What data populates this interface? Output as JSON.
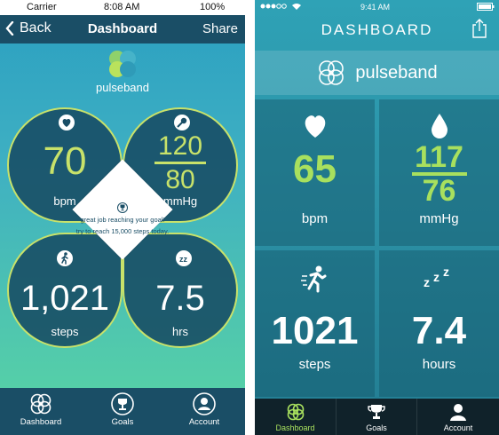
{
  "left": {
    "status": {
      "carrier": "Carrier",
      "time": "8:08 AM",
      "battery": "100%"
    },
    "nav": {
      "back": "Back",
      "title": "Dashboard",
      "share": "Share"
    },
    "brand": "pulseband",
    "heart_rate": {
      "value": "70",
      "unit": "bpm",
      "icon": "heart-icon"
    },
    "blood_pressure": {
      "systolic": "120",
      "diastolic": "80",
      "unit": "mmHg",
      "icon": "pressure-gauge-icon"
    },
    "steps": {
      "value": "1,021",
      "unit": "steps",
      "icon": "walking-icon"
    },
    "sleep": {
      "value": "7.5",
      "unit": "hrs",
      "icon": "sleep-icon"
    },
    "message": {
      "line1": "great job reaching your goal!",
      "line2": "try to reach 15,000 steps today.",
      "icon": "trophy-icon"
    },
    "tabs": [
      {
        "label": "Dashboard",
        "icon": "pulseband-logo-icon"
      },
      {
        "label": "Goals",
        "icon": "trophy-icon"
      },
      {
        "label": "Account",
        "icon": "user-icon"
      }
    ],
    "colors": {
      "accent": "#c8e26a",
      "nav": "#1a4e66"
    }
  },
  "right": {
    "status": {
      "time": "9:41 AM"
    },
    "title": "DASHBOARD",
    "brand": "pulseband",
    "heart_rate": {
      "value": "65",
      "unit": "bpm",
      "icon": "heart-icon"
    },
    "blood_pressure": {
      "systolic": "117",
      "diastolic": "76",
      "unit": "mmHg",
      "icon": "drop-icon"
    },
    "steps": {
      "value": "1021",
      "unit": "steps",
      "icon": "running-icon"
    },
    "sleep": {
      "value": "7.4",
      "unit": "hours",
      "icon": "zzz-icon"
    },
    "tabs": [
      {
        "label": "Dashboard",
        "icon": "pulseband-logo-icon",
        "active": true
      },
      {
        "label": "Goals",
        "icon": "trophy-icon"
      },
      {
        "label": "Account",
        "icon": "user-icon"
      }
    ],
    "colors": {
      "accent": "#a8e05e",
      "tabbar": "#10222a"
    }
  }
}
